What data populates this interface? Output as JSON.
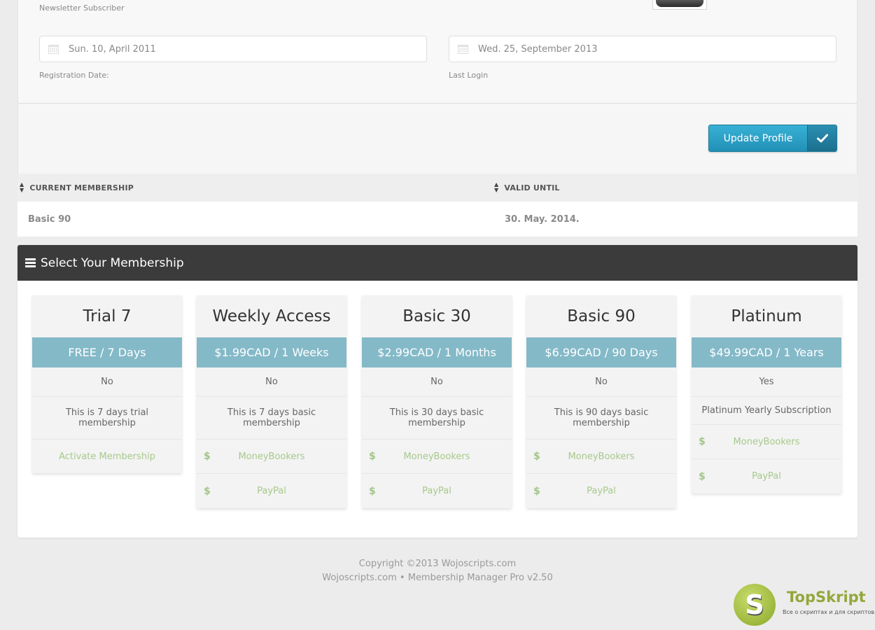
{
  "profile": {
    "newsletter_label": "Newsletter Subscriber",
    "registration_date_value": "Sun. 10, April 2011",
    "registration_date_label": "Registration Date:",
    "last_login_value": "Wed. 25, September 2013",
    "last_login_label": "Last Login",
    "update_button_label": "Update Profile"
  },
  "membership_table": {
    "headers": [
      "CURRENT MEMBERSHIP",
      "VALID UNTIL"
    ],
    "row": {
      "membership": "Basic 90",
      "valid_until": "30. May. 2014."
    }
  },
  "panel": {
    "title": "Select Your Membership",
    "plans": [
      {
        "name": "Trial 7",
        "price": "FREE / 7 Days",
        "recurring": "No",
        "description": [
          "This is 7 days trial",
          "membership"
        ],
        "action": "Activate Membership"
      },
      {
        "name": "Weekly Access",
        "price": "$1.99CAD / 1 Weeks",
        "recurring": "No",
        "description": [
          "This is 7 days basic",
          "membership"
        ],
        "gateways": [
          "MoneyBookers",
          "PayPal"
        ]
      },
      {
        "name": "Basic 30",
        "price": "$2.99CAD / 1 Months",
        "recurring": "No",
        "description": [
          "This is 30 days basic",
          "membership"
        ],
        "gateways": [
          "MoneyBookers",
          "PayPal"
        ]
      },
      {
        "name": "Basic 90",
        "price": "$6.99CAD / 90 Days",
        "recurring": "No",
        "description": [
          "This is 90 days basic",
          "membership"
        ],
        "gateways": [
          "MoneyBookers",
          "PayPal"
        ]
      },
      {
        "name": "Platinum",
        "price": "$49.99CAD / 1 Years",
        "recurring": "Yes",
        "description": [
          "Platinum Yearly Subscription"
        ],
        "gateways": [
          "MoneyBookers",
          "PayPal"
        ]
      }
    ],
    "currency_symbol": "$"
  },
  "footer": {
    "copyright": "Copyright ©2013 Wojoscripts.com",
    "product": "Wojoscripts.com • Membership Manager Pro v2.50"
  },
  "watermark": {
    "letter": "S",
    "brand": "TopSkript",
    "tagline": "Все о скриптах и для скриптов..."
  },
  "colors": {
    "accent_blue": "#2a9ac2",
    "price_band": "#84b9c8",
    "pay_link_green": "#a7c98b",
    "panel_header": "#3b3b3b"
  }
}
